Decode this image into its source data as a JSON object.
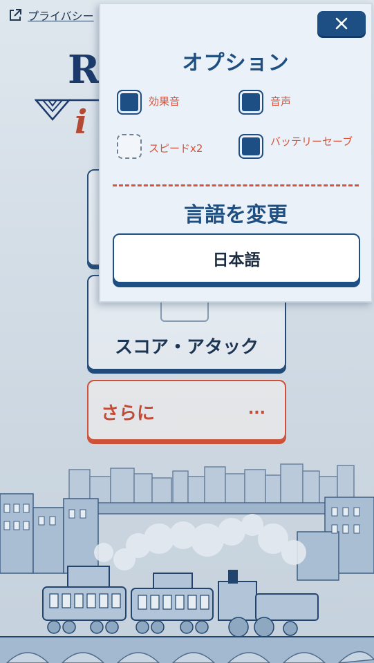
{
  "header": {
    "privacy_label": "プライバシー"
  },
  "menu": {
    "score_attack_label": "スコア・アタック",
    "more_label": "さらに",
    "more_dots": "..."
  },
  "options": {
    "title": "オプション",
    "close_icon": "close-icon",
    "items": [
      {
        "label": "効果音",
        "checked": true
      },
      {
        "label": "音声",
        "checked": true
      },
      {
        "label": "スピードx2",
        "checked": false
      },
      {
        "label": "バッテリーセーブ",
        "checked": true
      }
    ],
    "language_title": "言語を変更",
    "language_value": "日本語"
  },
  "colors": {
    "primary_blue": "#1d4f85",
    "accent_red": "#d7533a",
    "panel_bg": "#eaf1f8"
  }
}
